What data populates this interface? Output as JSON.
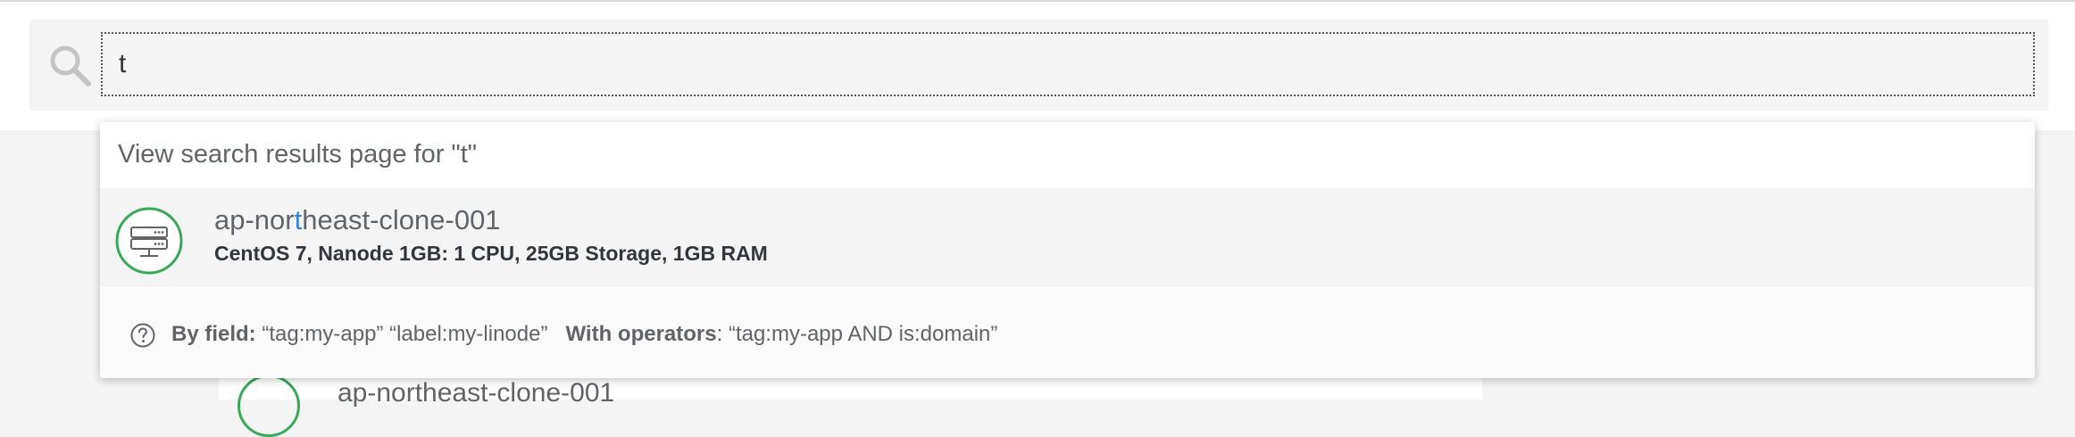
{
  "search": {
    "value": "t",
    "placeholder": ""
  },
  "dropdown": {
    "view_all_label": "View search results page for \"t\"",
    "results": [
      {
        "title_prefix": "ap-nor",
        "title_match": "t",
        "title_suffix": "heast-clone-001",
        "description": "CentOS 7, Nanode 1GB: 1 CPU, 25GB Storage, 1GB RAM",
        "icon": "linode-server-icon",
        "status_color": "#3aa85a"
      }
    ],
    "help": {
      "by_field_label": "By field:",
      "by_field_examples": "“tag:my-app” “label:my-linode”",
      "operators_label": "With operators",
      "operators_example": ": “tag:my-app AND is:domain”"
    }
  },
  "background": {
    "row_title": "ap-northeast-clone-001"
  },
  "colors": {
    "accent": "#3683dc",
    "status_green": "#3aa85a",
    "text_muted": "#606469"
  }
}
